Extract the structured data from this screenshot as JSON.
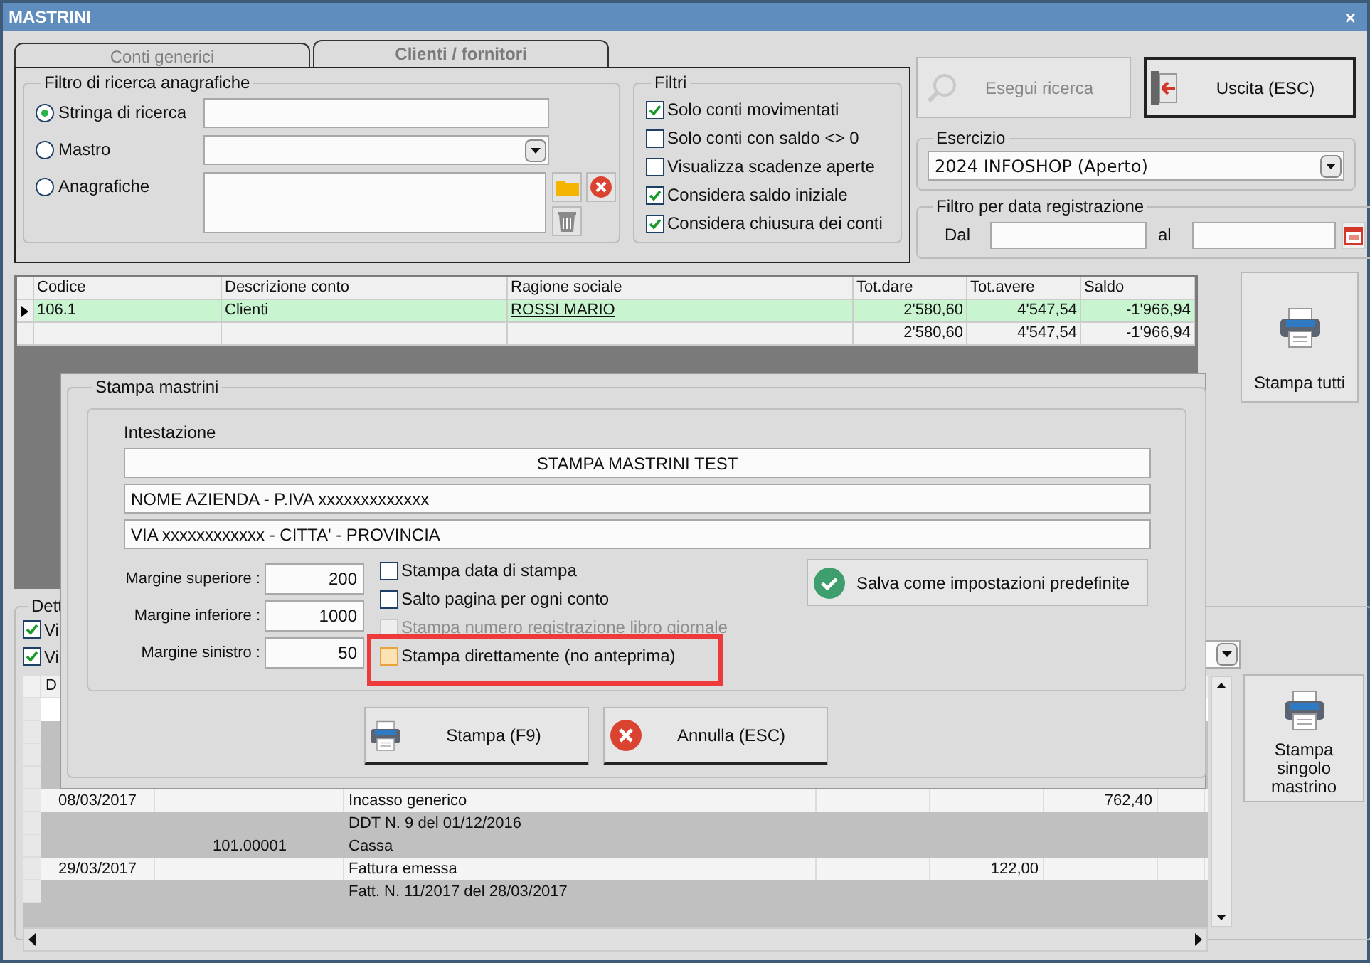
{
  "window": {
    "title": "MASTRINI",
    "close": "×"
  },
  "tabs": [
    {
      "label": "Conti generici",
      "selected": false
    },
    {
      "label": "Clienti / fornitori",
      "selected": true
    }
  ],
  "search_filter": {
    "title": "Filtro di ricerca anagrafiche",
    "options": [
      {
        "label": "Stringa di ricerca",
        "selected": true,
        "kind": "text"
      },
      {
        "label": "Mastro",
        "selected": false,
        "kind": "select"
      },
      {
        "label": "Anagrafiche",
        "selected": false,
        "kind": "list"
      }
    ]
  },
  "filters": {
    "title": "Filtri",
    "items": [
      {
        "label": "Solo conti movimentati",
        "checked": true
      },
      {
        "label": "Solo conti con saldo <> 0",
        "checked": false
      },
      {
        "label": "Visualizza scadenze aperte",
        "checked": false
      },
      {
        "label": "Considera saldo iniziale",
        "checked": true
      },
      {
        "label": "Considera chiusura dei conti",
        "checked": true
      }
    ]
  },
  "search_button": {
    "label": "Esegui ricerca",
    "disabled": true
  },
  "exit_button": {
    "label": "Uscita (ESC)"
  },
  "esercizio": {
    "title": "Esercizio",
    "value": "2024 INFOSHOP (Aperto)"
  },
  "date_filter": {
    "title": "Filtro per data registrazione",
    "from_label": "Dal",
    "to_label": "al"
  },
  "accounts_table": {
    "columns": [
      "Codice",
      "Descrizione conto",
      "Ragione sociale",
      "Tot.dare",
      "Tot.avere",
      "Saldo"
    ],
    "rows": [
      {
        "selected": true,
        "code": "106.1",
        "description": "Clienti",
        "name": "ROSSI MARIO",
        "dare": "2'580,60",
        "avere": "4'547,54",
        "saldo": "-1'966,94"
      },
      {
        "selected": false,
        "dare": "2'580,60",
        "avere": "4'547,54",
        "saldo": "-1'966,94"
      }
    ]
  },
  "print_all_button": "Stampa tutti",
  "detail": {
    "title": "Dett",
    "checkboxes": [
      {
        "label": "Vi",
        "checked": true
      },
      {
        "label": "Vi",
        "checked": true
      }
    ],
    "header": "D",
    "rows": [
      {
        "kind": "entry",
        "column_1": "08/03/2017",
        "column_3": "Incasso generico",
        "column_6": "762,40"
      },
      {
        "kind": "detail",
        "column_3": "DDT N. 9 del 01/12/2016"
      },
      {
        "kind": "detail",
        "column_2": "101.00001",
        "column_3": "Cassa"
      },
      {
        "kind": "entry",
        "column_1": "29/03/2017",
        "column_3": "Fattura emessa",
        "column_5": "122,00"
      },
      {
        "kind": "detail",
        "column_3": "Fatt. N. 11/2017 del 28/03/2017"
      }
    ]
  },
  "print_single_button": "Stampa singolo mastrino",
  "dialog": {
    "title": "Stampa mastrini",
    "header_label": "Intestazione",
    "header_lines": [
      "STAMPA MASTRINI TEST",
      "NOME AZIENDA - P.IVA xxxxxxxxxxxxx",
      "VIA xxxxxxxxxxxx - CITTA' - PROVINCIA"
    ],
    "margins": [
      {
        "label": "Margine superiore :",
        "value": "200"
      },
      {
        "label": "Margine inferiore :",
        "value": "1000"
      },
      {
        "label": "Margine sinistro :",
        "value": "50"
      }
    ],
    "options": [
      {
        "label": "Stampa data di stampa",
        "checked": false,
        "disabled": false,
        "highlighted": false
      },
      {
        "label": "Salto pagina per ogni conto",
        "checked": false,
        "disabled": false,
        "highlighted": false
      },
      {
        "label": "Stampa numero registrazione libro giornale",
        "checked": false,
        "disabled": true,
        "highlighted": false
      },
      {
        "label": "Stampa direttamente (no anteprima)",
        "checked": false,
        "disabled": false,
        "highlighted": true
      }
    ],
    "save_button": "Salva come impostazioni predefinite",
    "print_button": "Stampa (F9)",
    "cancel_button": "Annulla (ESC)"
  }
}
